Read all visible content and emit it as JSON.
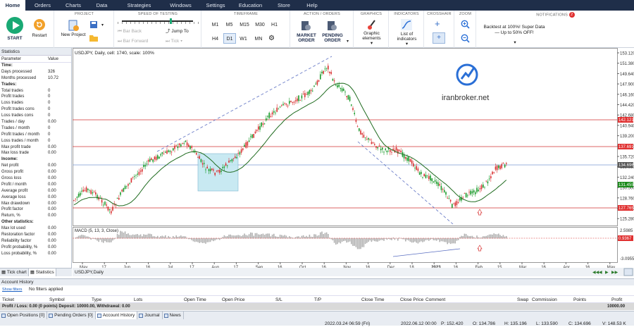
{
  "menu": [
    "Home",
    "Orders",
    "Charts",
    "Data",
    "Strategies",
    "Windows",
    "Settings",
    "Education",
    "Store",
    "Help"
  ],
  "ribbon": {
    "start": "START",
    "restart": "Restart",
    "project_title": "PROJECT",
    "new_project": "New Project",
    "speed_title": "SPEED OF TESTING",
    "bar_back": "Bar Back",
    "bar_forward": "Bar Forward",
    "jump_to": "Jump To",
    "tick": "Tick",
    "timeframe_title": "TIMEFRAME",
    "timeframes": [
      "M1",
      "M5",
      "M15",
      "M30",
      "H1",
      "H4",
      "D1",
      "W1",
      "MN"
    ],
    "selected_timeframe": "D1",
    "action_title": "ACTION / ORDERS",
    "market_order": "MARKET ORDER",
    "pending_order": "PENDING ORDER",
    "graphics_title": "GRAPHICS",
    "graphic_elements": "Graphic elements",
    "indicators_title": "INDICATORS",
    "list_of_indicators": "List of indicators",
    "crosshair_title": "CROSSHAIR",
    "zoom_title": "ZOOM",
    "notifications_title": "NOTIFICATIONS",
    "notification_badge": "2",
    "notification_text": "Backtest at 100%! Super Data — Up to 50% OFF!"
  },
  "stats": {
    "title": "Statistics",
    "col_param": "Parameter",
    "col_value": "Value",
    "rows": [
      {
        "n": "Time:",
        "v": "",
        "sec": true
      },
      {
        "n": "Days processed",
        "v": "326"
      },
      {
        "n": "Months processed",
        "v": "10.72"
      },
      {
        "n": "Trades:",
        "v": "",
        "sec": true
      },
      {
        "n": "Total trades",
        "v": "0"
      },
      {
        "n": "Profit trades",
        "v": "0"
      },
      {
        "n": "Loss trades",
        "v": "0"
      },
      {
        "n": "Profit trades cons",
        "v": "0"
      },
      {
        "n": "Loss trades cons",
        "v": "0"
      },
      {
        "n": "Trades / day",
        "v": "0.00"
      },
      {
        "n": "Trades / month",
        "v": "0"
      },
      {
        "n": "Profit trades / month",
        "v": "0"
      },
      {
        "n": "Loss trades / month",
        "v": "0"
      },
      {
        "n": "Max profit trade",
        "v": "0.00"
      },
      {
        "n": "Max loss trade",
        "v": "0.00"
      },
      {
        "n": "Income:",
        "v": "",
        "sec": true
      },
      {
        "n": "Net profit",
        "v": "0.00"
      },
      {
        "n": "Gross profit",
        "v": "0.00"
      },
      {
        "n": "Gross loss",
        "v": "0.00"
      },
      {
        "n": "Profit / month",
        "v": "0.00"
      },
      {
        "n": "Average profit",
        "v": "0.00"
      },
      {
        "n": "Average loss",
        "v": "0.00"
      },
      {
        "n": "Max drawdown",
        "v": "0.00"
      },
      {
        "n": "Profit factor",
        "v": "0.00"
      },
      {
        "n": "Return, %",
        "v": "0.00"
      },
      {
        "n": "Other statistics:",
        "v": "",
        "sec": true
      },
      {
        "n": "Max lot used",
        "v": "0.00"
      },
      {
        "n": "Restoration factor",
        "v": "0.00"
      },
      {
        "n": "Reliability factor",
        "v": "0.00"
      },
      {
        "n": "Profit probability, %",
        "v": "0.00"
      },
      {
        "n": "Loss probability, %",
        "v": "0.00"
      }
    ],
    "tabs": [
      "Tick chart",
      "Statistics"
    ]
  },
  "chart": {
    "header": "USDJPY, Daily, cell: 1740, scale: 100%",
    "watermark": "iranbroker.net",
    "macd_header": "MACD (5, 13, 3, Close)",
    "bottom_tab": "USDJPY,Daily",
    "price_labels": [
      "153.120",
      "151.380",
      "149.640",
      "147.900",
      "146.160",
      "144.420",
      "142.680",
      "140.940",
      "139.200",
      "137.460",
      "135.720",
      "133.980",
      "132.240",
      "130.500",
      "128.760",
      "127.020",
      "125.280"
    ],
    "macd_labels": [
      "2.5985",
      "0.9367",
      "-3.0955"
    ],
    "price_tags": [
      {
        "v": "142.121",
        "color": "#e03030"
      },
      {
        "v": "137.691",
        "color": "#e03030"
      },
      {
        "v": "134.696",
        "color": "#555555"
      },
      {
        "v": "131.455",
        "color": "#1a8a1a"
      },
      {
        "v": "127.765",
        "color": "#e03030"
      }
    ],
    "macd_tag": "0.9367",
    "date_labels": [
      "May",
      "17",
      "Jun",
      "16",
      "Jul",
      "17",
      "Aug",
      "17",
      "Sep",
      "16",
      "Oct",
      "16",
      "Nov",
      "16",
      "Dec",
      "18",
      "2023",
      "16",
      "Feb",
      "15",
      "Mar",
      "16",
      "Apr",
      "16",
      "May"
    ],
    "colors": {
      "bull": "#1a9a2a",
      "bear": "#d83030",
      "ma": "#1f6b1f",
      "line_red": "#d03030",
      "line_blue": "#7a9ad0",
      "box": "#bfe6f0"
    }
  },
  "account": {
    "title": "Account History",
    "show_filters": "Show filters",
    "no_filters": "No filters applied",
    "columns": [
      "Ticket",
      "Symbol",
      "Type",
      "Lots",
      "Open Time",
      "Open Price",
      "S/L",
      "T/P",
      "Close Time",
      "Close Price",
      "Comment",
      "Swap",
      "Commission",
      "Points",
      "Profit"
    ],
    "pl_text": "Profit / Loss: 0.00 (0 points) Deposit: 10000.00, Withdrawal: 0.00",
    "pl_value": "10000.00",
    "tabs": [
      "Open Positions [0]",
      "Pending Orders [0]",
      "Account History",
      "Journal",
      "News"
    ]
  },
  "status": [
    "2022.03.24 06:59 (Fri)",
    "2022.06.12 00:00",
    "P: 152.420",
    "O: 134.786",
    "H: 135.196",
    "L: 133.590",
    "C: 134.696",
    "V: 148.53 K"
  ]
}
